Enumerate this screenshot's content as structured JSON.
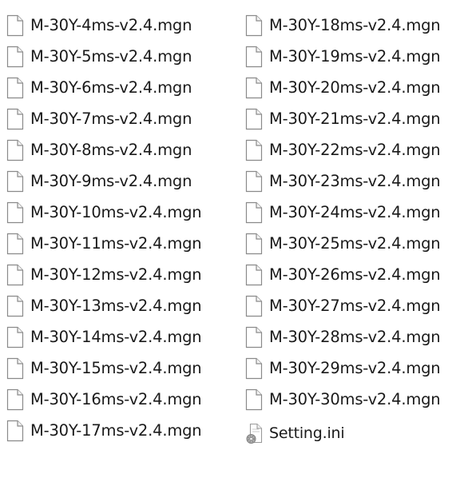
{
  "files": [
    {
      "name": "M-30Y-4ms-v2.4.mgn",
      "icon": "blank-file-icon"
    },
    {
      "name": "M-30Y-5ms-v2.4.mgn",
      "icon": "blank-file-icon"
    },
    {
      "name": "M-30Y-6ms-v2.4.mgn",
      "icon": "blank-file-icon"
    },
    {
      "name": "M-30Y-7ms-v2.4.mgn",
      "icon": "blank-file-icon"
    },
    {
      "name": "M-30Y-8ms-v2.4.mgn",
      "icon": "blank-file-icon"
    },
    {
      "name": "M-30Y-9ms-v2.4.mgn",
      "icon": "blank-file-icon"
    },
    {
      "name": "M-30Y-10ms-v2.4.mgn",
      "icon": "blank-file-icon"
    },
    {
      "name": "M-30Y-11ms-v2.4.mgn",
      "icon": "blank-file-icon"
    },
    {
      "name": "M-30Y-12ms-v2.4.mgn",
      "icon": "blank-file-icon"
    },
    {
      "name": "M-30Y-13ms-v2.4.mgn",
      "icon": "blank-file-icon"
    },
    {
      "name": "M-30Y-14ms-v2.4.mgn",
      "icon": "blank-file-icon"
    },
    {
      "name": "M-30Y-15ms-v2.4.mgn",
      "icon": "blank-file-icon"
    },
    {
      "name": "M-30Y-16ms-v2.4.mgn",
      "icon": "blank-file-icon"
    },
    {
      "name": "M-30Y-17ms-v2.4.mgn",
      "icon": "blank-file-icon"
    },
    {
      "name": "M-30Y-18ms-v2.4.mgn",
      "icon": "blank-file-icon"
    },
    {
      "name": "M-30Y-19ms-v2.4.mgn",
      "icon": "blank-file-icon"
    },
    {
      "name": "M-30Y-20ms-v2.4.mgn",
      "icon": "blank-file-icon"
    },
    {
      "name": "M-30Y-21ms-v2.4.mgn",
      "icon": "blank-file-icon"
    },
    {
      "name": "M-30Y-22ms-v2.4.mgn",
      "icon": "blank-file-icon"
    },
    {
      "name": "M-30Y-23ms-v2.4.mgn",
      "icon": "blank-file-icon"
    },
    {
      "name": "M-30Y-24ms-v2.4.mgn",
      "icon": "blank-file-icon"
    },
    {
      "name": "M-30Y-25ms-v2.4.mgn",
      "icon": "blank-file-icon"
    },
    {
      "name": "M-30Y-26ms-v2.4.mgn",
      "icon": "blank-file-icon"
    },
    {
      "name": "M-30Y-27ms-v2.4.mgn",
      "icon": "blank-file-icon"
    },
    {
      "name": "M-30Y-28ms-v2.4.mgn",
      "icon": "blank-file-icon"
    },
    {
      "name": "M-30Y-29ms-v2.4.mgn",
      "icon": "blank-file-icon"
    },
    {
      "name": "M-30Y-30ms-v2.4.mgn",
      "icon": "blank-file-icon"
    },
    {
      "name": "Setting.ini",
      "icon": "settings-file-icon"
    }
  ]
}
